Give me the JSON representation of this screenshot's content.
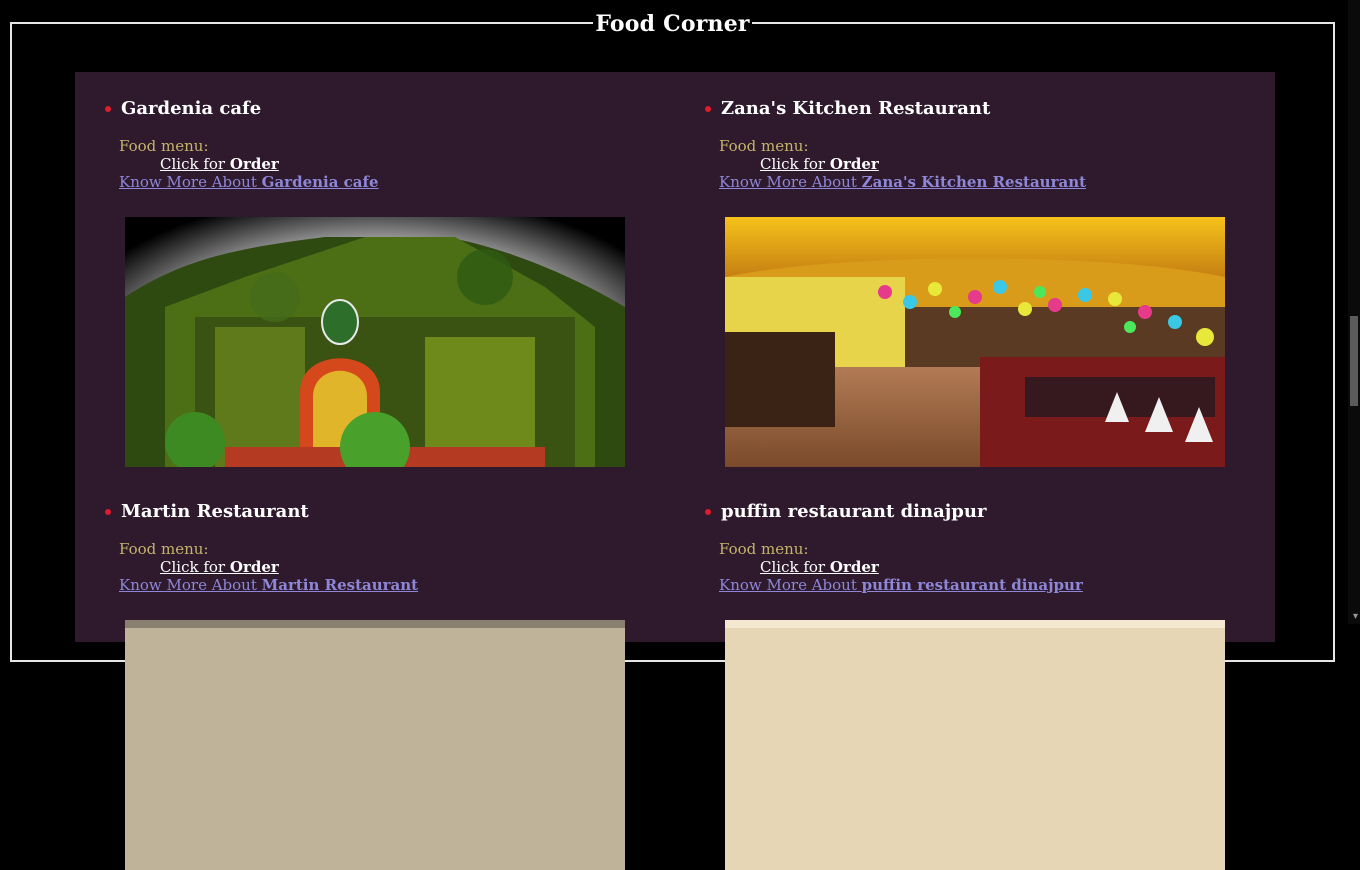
{
  "page": {
    "heading": "Food Corner"
  },
  "labels": {
    "menu": "Food menu:",
    "click_prefix": "Click for",
    "click_bold": "Order",
    "know_prefix": "Know More About"
  },
  "restaurants": [
    {
      "name": "Gardenia cafe"
    },
    {
      "name": "Zana's Kitchen Restaurant"
    },
    {
      "name": "Martin Restaurant"
    },
    {
      "name": "puffin restaurant dinajpur"
    }
  ],
  "colors": {
    "panel": "#2e1a2c",
    "bullet": "#e01e2b",
    "menu_text": "#c5b36c",
    "know_link": "#8e87d8"
  }
}
